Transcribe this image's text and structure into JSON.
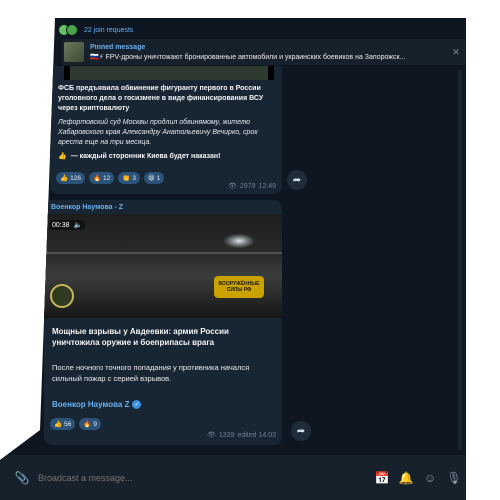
{
  "header": {
    "join_requests": "22 join requests"
  },
  "pinned": {
    "title": "Pinned message",
    "text": "🇷🇺⚡ FPV-дроны уничтожают бронированные автомобили и украинских боевиков на Запорожск...",
    "close_icon": "close-icon"
  },
  "message1": {
    "bold_text": "ФСБ предъявила обвинение фигуранту первого в России уголовного дела о госизмене в виде финансирования ВСУ через криптовалюту",
    "italic_text": "Лефортовский суд Москвы продлил обвинямому, жителю Хабаровского края Александру Анатольевичу Вечирко, срок ареста еще на три месяца.",
    "cta_emoji": "👍",
    "cta_text": "— каждый сторонник Киева будет наказан!",
    "reactions": [
      {
        "emoji": "👍",
        "count": "126"
      },
      {
        "emoji": "🔥",
        "count": "12"
      },
      {
        "emoji": "👏",
        "count": "3"
      },
      {
        "emoji": "😁",
        "count": "1"
      }
    ],
    "views": "2979",
    "time": "12:49"
  },
  "message2": {
    "channel": "Военкор Наумова - Z",
    "video_time": "00:38",
    "video_logo_text": "ВООРУЖЁННЫЕ СИЛЫ РФ",
    "headline": "Мощные взрывы у Авдеевки: армия России уничтожила оружие и боеприпасы врага",
    "body": "После ночного точного попадания у противника начался сильный пожар с серией взрывов.",
    "signature": "Военкор Наумова Z",
    "reactions": [
      {
        "emoji": "👍",
        "count": "56"
      },
      {
        "emoji": "🔥",
        "count": "9"
      }
    ],
    "views": "1339",
    "edited_time": "edited 14:03"
  },
  "composer": {
    "placeholder": "Broadcast a message..."
  },
  "colors": {
    "background": "#0e1621",
    "bubble": "#182533",
    "accent": "#6ab2f2",
    "reaction": "#2b5278"
  }
}
